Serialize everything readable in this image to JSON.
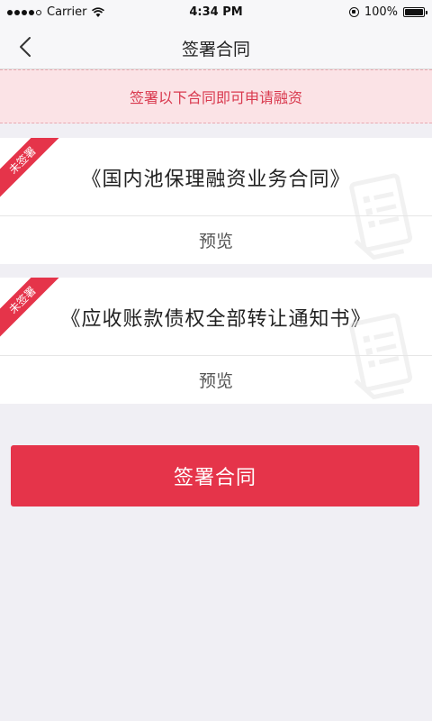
{
  "status_bar": {
    "carrier": "Carrier",
    "time": "4:34 PM",
    "battery": "100%"
  },
  "nav": {
    "title": "签署合同",
    "back_icon": "chevron-left-icon"
  },
  "notice": {
    "text": "签署以下合同即可申请融资",
    "color": "#d9394e"
  },
  "contracts": [
    {
      "badge": "未签署",
      "title": "《国内池保理融资业务合同》",
      "preview_label": "预览"
    },
    {
      "badge": "未签署",
      "title": "《应收账款债权全部转让通知书》",
      "preview_label": "预览"
    }
  ],
  "sign_button": {
    "label": "签署合同",
    "color": "#e5344a"
  }
}
